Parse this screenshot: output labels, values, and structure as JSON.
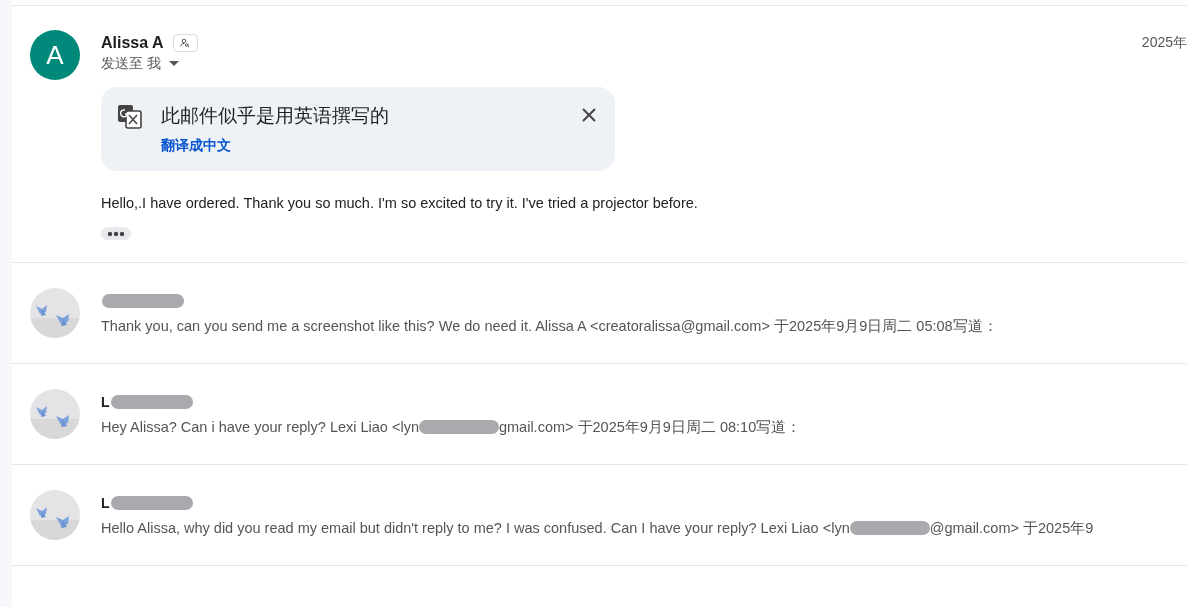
{
  "message": {
    "avatar_initial": "A",
    "sender": "Alissa A",
    "recipient": "发送至 我",
    "date": "2025年",
    "translate_banner": {
      "title": "此邮件似乎是用英语撰写的",
      "link": "翻译成中文"
    },
    "body": "Hello,.I have ordered. Thank you so much. I'm so excited to try it. I've tried a projector before."
  },
  "thread": [
    {
      "name_redacted": true,
      "snippet_parts": [
        "Thank you, can you send me a screenshot like this? We do need it. Alissa A <creatoralissa@gmail.com> 于2025年9月9日周二 05:08写道："
      ]
    },
    {
      "sender": "L",
      "name_redacted": true,
      "snippet_parts": [
        "Hey Alissa? Can i have your reply? Lexi Liao <lyn",
        "gmail.com> 于2025年9月9日周二 08:10写道："
      ]
    },
    {
      "sender": "L",
      "name_redacted": true,
      "snippet_parts": [
        "Hello Alissa, why did you read my email but didn't reply to me? I was confused. Can I have your reply? Lexi Liao <lyn",
        "@gmail.com> 于2025年9"
      ]
    }
  ]
}
